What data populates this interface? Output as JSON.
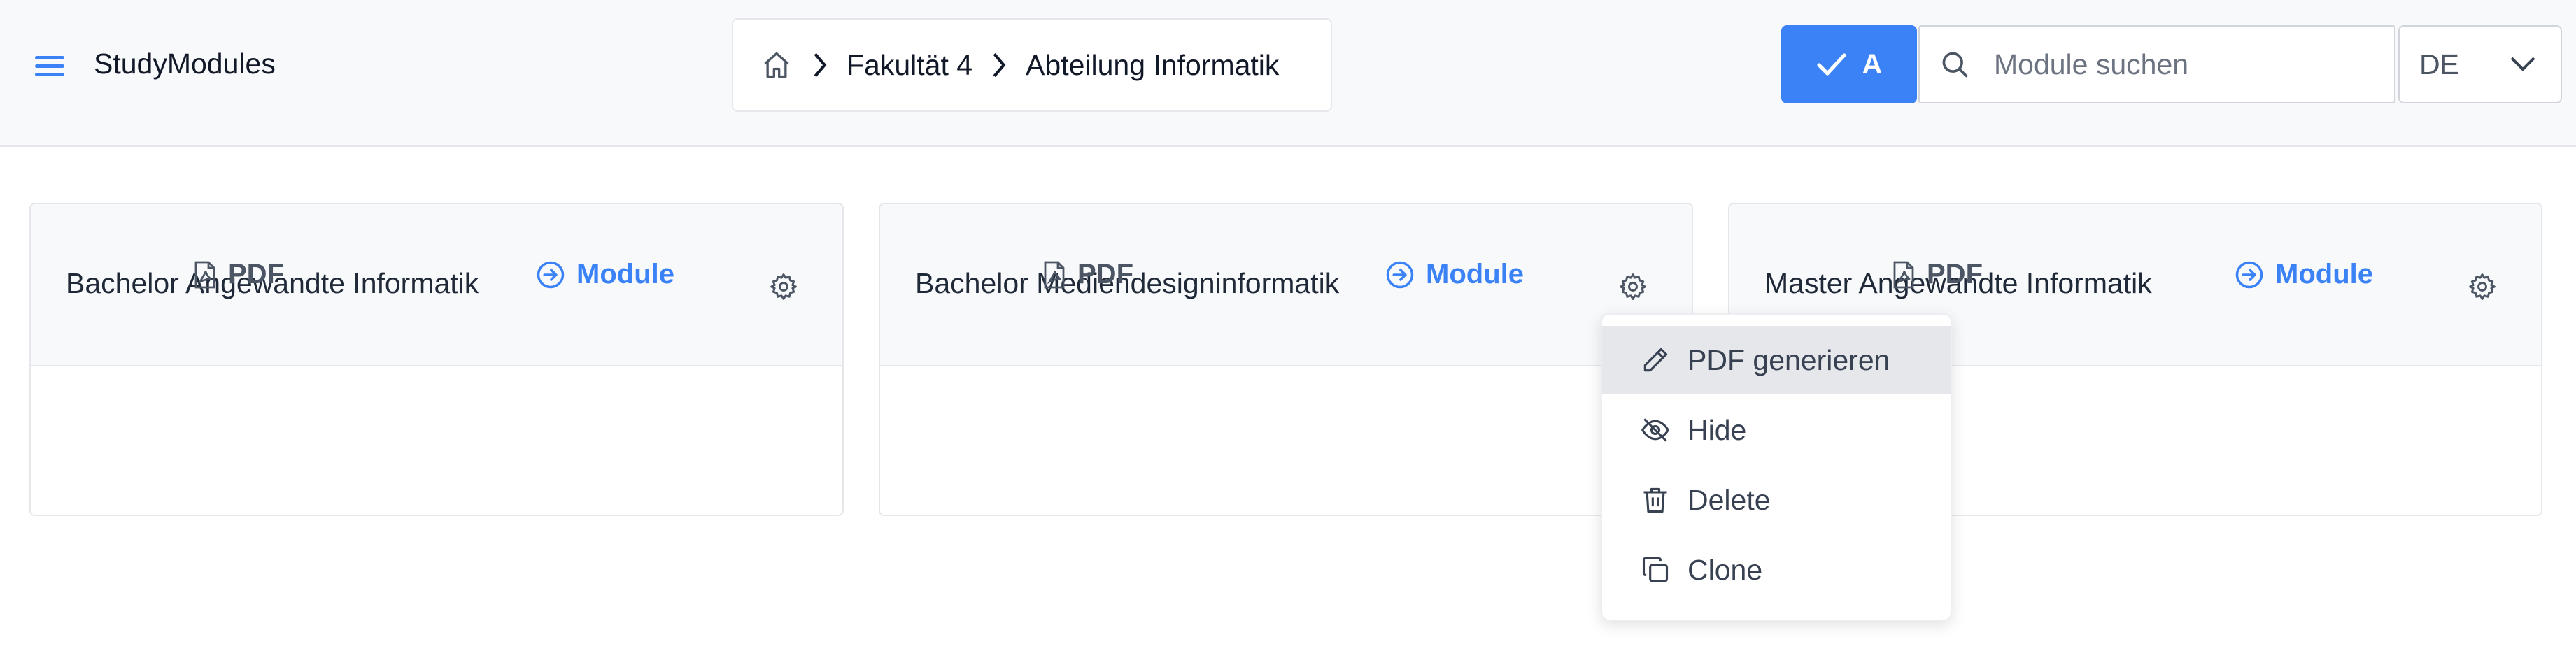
{
  "header": {
    "app_title": "StudyModules",
    "breadcrumb": [
      "Fakultät 4",
      "Abteilung Informatik"
    ],
    "confirm_label": "A",
    "search_placeholder": "Module suchen",
    "language": "DE"
  },
  "cards": [
    {
      "title": "Bachelor Angewandte Informatik",
      "pdf_label": "PDF",
      "module_label": "Module"
    },
    {
      "title": "Bachelor Mediendesigninformatik",
      "pdf_label": "PDF",
      "module_label": "Module"
    },
    {
      "title": "Master Angewandte Informatik",
      "pdf_label": "PDF",
      "module_label": "Module"
    }
  ],
  "context_menu": {
    "items": [
      {
        "label": "PDF generieren",
        "icon": "pencil-icon"
      },
      {
        "label": "Hide",
        "icon": "eye-off-icon"
      },
      {
        "label": "Delete",
        "icon": "trash-icon"
      },
      {
        "label": "Clone",
        "icon": "copy-icon"
      }
    ]
  },
  "colors": {
    "accent": "#3b82f6",
    "header_bg": "#f8f9fb",
    "border": "#e5e7eb",
    "menu_active": "#e5e7eb"
  }
}
